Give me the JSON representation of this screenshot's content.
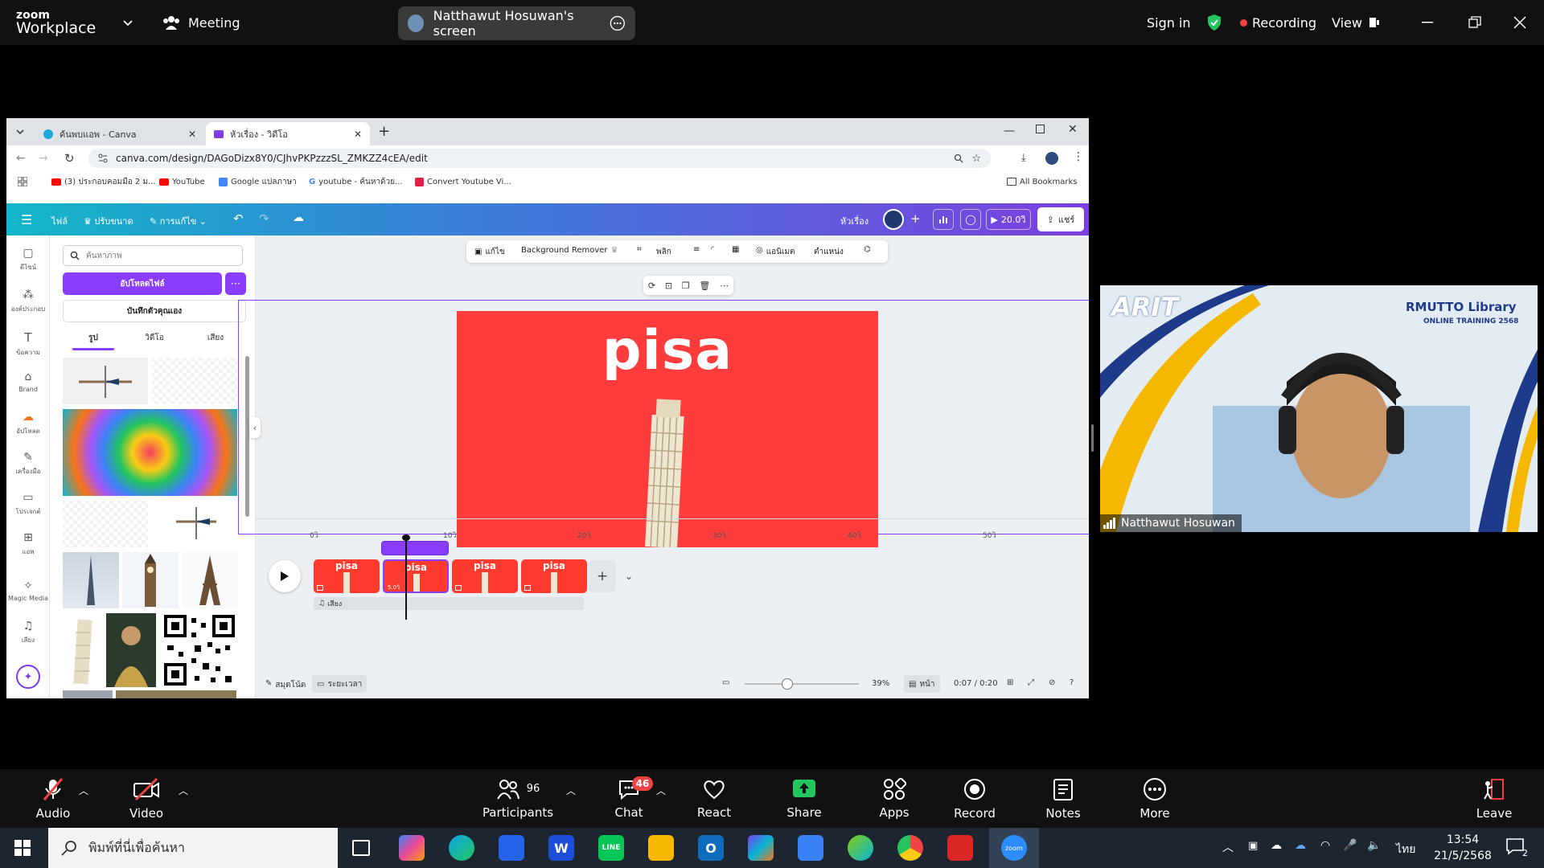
{
  "zoom_top": {
    "brand_top": "zoom",
    "brand_bottom": "Workplace",
    "meeting_label": "Meeting",
    "screen_share_label": "Natthawut Hosuwan's screen",
    "sign_in": "Sign in",
    "recording": "Recording",
    "view": "View"
  },
  "browser": {
    "tabs": [
      {
        "title": "ค้นพบแอพ - Canva"
      },
      {
        "title": "หัวเรื่อง - วิดีโอ"
      }
    ],
    "url": "canva.com/design/DAGoDizx8Y0/CJhvPKPzzzSL_ZMKZZ4cEA/edit",
    "bookmarks": [
      {
        "label": "(3) ประกอบคอมมือ 2 ม..."
      },
      {
        "label": "YouTube"
      },
      {
        "label": "Google แปลภาษา"
      },
      {
        "label": "youtube - ค้นหาด้วย..."
      },
      {
        "label": "Convert Youtube Vi..."
      }
    ],
    "all_bookmarks": "All Bookmarks"
  },
  "canva": {
    "menu_file": "ไฟล์",
    "menu_resize": "ปรับขนาด",
    "menu_edit": "การแก้ไข",
    "doc_title": "หัวเรื่อง",
    "play_duration": "20.0วิ",
    "share": "แชร์",
    "rail": [
      {
        "label": "ดีไซน์"
      },
      {
        "label": "องค์ประกอบ"
      },
      {
        "label": "ข้อความ"
      },
      {
        "label": "Brand"
      },
      {
        "label": "อัปโหลด"
      },
      {
        "label": "เครื่องมือ"
      },
      {
        "label": "โปรเจกต์"
      },
      {
        "label": "แอพ"
      },
      {
        "label": "Magic Media"
      },
      {
        "label": "เสียง"
      }
    ],
    "search_placeholder": "ค้นหาภาพ",
    "upload_button": "อัปโหลดไฟล์",
    "record_button": "บันทึกตัวคุณเอง",
    "panel_tabs": [
      {
        "label": "รูป"
      },
      {
        "label": "วิดีโอ"
      },
      {
        "label": "เสียง"
      }
    ],
    "context_toolbar": {
      "edit": "แก้ไข",
      "bg_remover": "Background Remover",
      "flip": "พลิก",
      "animate": "แอนิเมต",
      "position": "ตำแหน่ง"
    },
    "slide_title": "pisa",
    "timeline": {
      "ticks": [
        "0วิ",
        "10วิ",
        "20วิ",
        "30วิ",
        "40วิ",
        "50วิ"
      ],
      "clips": [
        {
          "label": "pisa"
        },
        {
          "label": "pisa",
          "badge": "5.0วิ"
        },
        {
          "label": "pisa"
        },
        {
          "label": "pisa"
        }
      ],
      "audio_track": "เสียง"
    },
    "bottom": {
      "notes": "สมุดโน้ต",
      "duration": "ระยะเวลา",
      "zoom_pct": "39%",
      "pages": "หน้า",
      "time": "0:07 / 0:20"
    }
  },
  "video_tile": {
    "participant_name": "Natthawut Hosuwan",
    "logo_text": "ARIT",
    "library_title": "RMUTTO Library",
    "library_subtitle": "ONLINE TRAINING 2568"
  },
  "zoom_controls": {
    "audio": "Audio",
    "video": "Video",
    "participants": "Participants",
    "participants_count": "96",
    "chat": "Chat",
    "chat_badge": "46",
    "react": "React",
    "share": "Share",
    "apps": "Apps",
    "record": "Record",
    "notes": "Notes",
    "more": "More",
    "leave": "Leave"
  },
  "taskbar": {
    "search_placeholder": "พิมพ์ที่นี่เพื่อค้นหา",
    "lang": "ไทย",
    "time": "13:54",
    "date": "21/5/2568",
    "notif_count": "2"
  }
}
